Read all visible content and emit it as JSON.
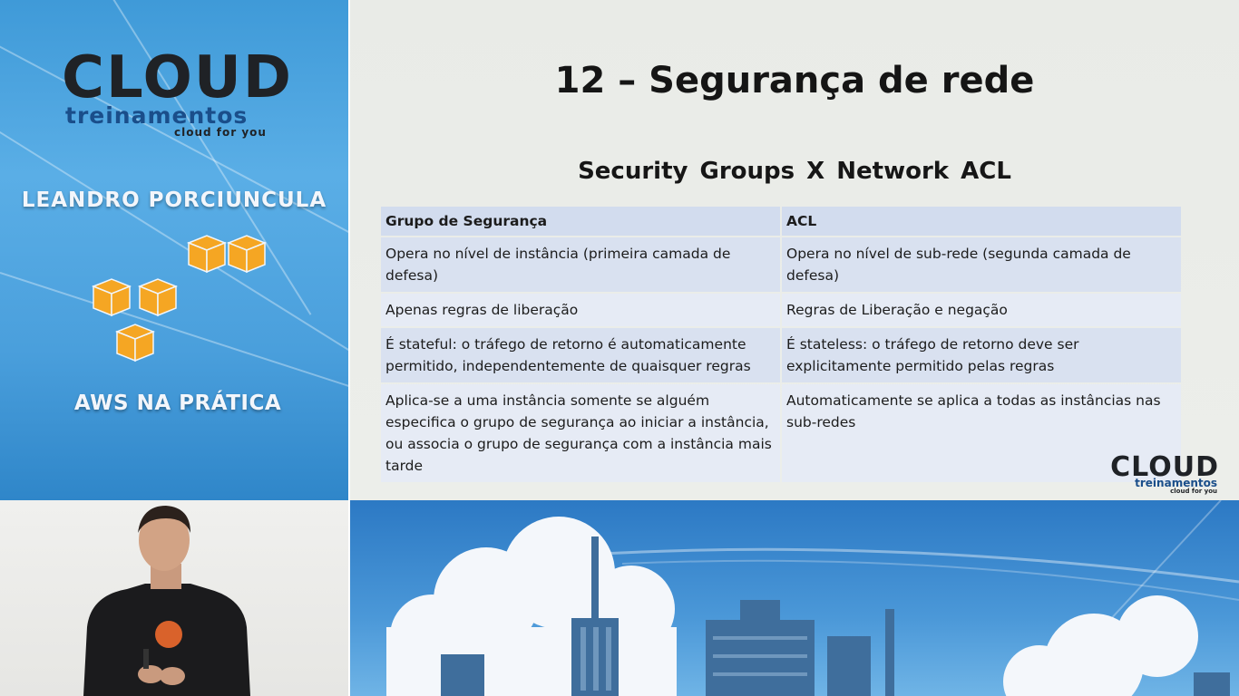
{
  "sidebar": {
    "logo": {
      "word": "CLOUD",
      "sub": "treinamentos",
      "tagline": "cloud for you"
    },
    "presenter": "LEANDRO PORCIUNCULA",
    "course": "AWS NA PRÁTICA",
    "icon": "aws-cubes-icon"
  },
  "slide": {
    "title": "12 – Segurança de rede",
    "subtitle": "Security Groups  X   Network ACL",
    "table": {
      "headers": [
        "Grupo de Segurança",
        "ACL"
      ],
      "rows": [
        [
          "Opera no nível de instância (primeira camada de defesa)",
          "Opera no nível de sub-rede (segunda camada de defesa)"
        ],
        [
          "Apenas regras de liberação",
          "Regras de Liberação  e negação"
        ],
        [
          "É stateful: o tráfego de retorno é automaticamente permitido, independentemente de quaisquer regras",
          "É stateless: o tráfego de retorno deve ser explicitamente permitido pelas regras"
        ],
        [
          "Aplica-se a uma instância somente se alguém especifica o grupo de segurança ao iniciar a instância, ou associa o grupo de segurança com a instância mais tarde",
          "Automaticamente se aplica a todas as instâncias nas sub-redes"
        ]
      ]
    },
    "corner_logo": {
      "word": "CLOUD",
      "sub": "treinamentos",
      "tagline": "cloud for you"
    }
  },
  "colors": {
    "sidebar": "#4a9fdc",
    "slide_bg": "#eaece8",
    "table_header": "#d2dcee",
    "table_cell": "#d9e1f0",
    "cube": "#f5a623"
  }
}
